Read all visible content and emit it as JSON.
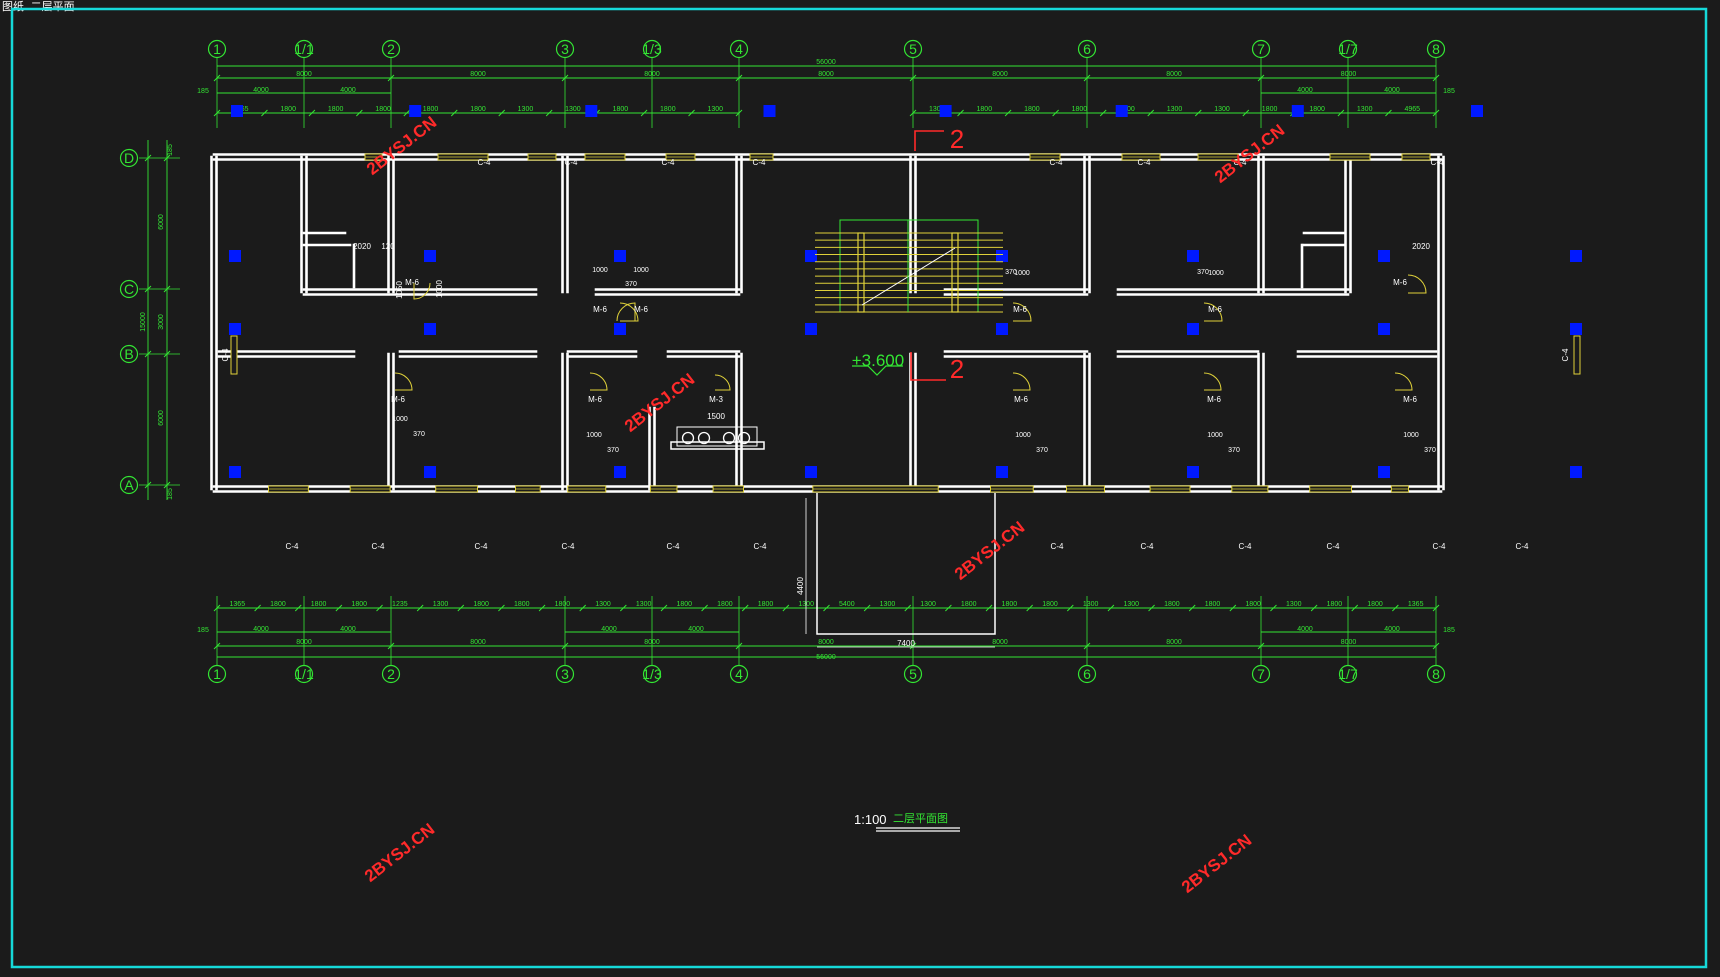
{
  "corner_tag": "图纸 二层平面",
  "grid_axes": [
    "1",
    "1/1",
    "2",
    "3",
    "1/3",
    "4",
    "5",
    "6",
    "7",
    "1/7",
    "8"
  ],
  "grid_rows": [
    "D",
    "C",
    "B",
    "A"
  ],
  "overall_dimension": "56000",
  "bay_dimensions": [
    "8000",
    "8000",
    "8000",
    "8000",
    "8000",
    "8000",
    "8000"
  ],
  "sub_dimensions_left": [
    "4000",
    "4000"
  ],
  "sub_dimensions_right": [
    "4000",
    "4000"
  ],
  "edge_dimension": "185",
  "top_detail_dims": [
    "4965",
    "1800",
    "1800",
    "1800",
    "1800",
    "1800",
    "1300",
    "1300",
    "1800",
    "1800",
    "1300",
    "1300",
    "1800",
    "1800",
    "1800",
    "1800",
    "1300",
    "1300",
    "1800",
    "1800",
    "1300",
    "4965"
  ],
  "bottom_detail_dims": [
    "1365",
    "1800",
    "1800",
    "1800",
    "1235",
    "1300",
    "1800",
    "1800",
    "1800",
    "1300",
    "1300",
    "1800",
    "1800",
    "1800",
    "1300",
    "5400",
    "1300",
    "1300",
    "1800",
    "1800",
    "1800",
    "1300",
    "1300",
    "1800",
    "1800",
    "1800",
    "1300",
    "1800",
    "1800",
    "1365"
  ],
  "left_dims": [
    "6000",
    "3000",
    "6000",
    "15000"
  ],
  "window_label": "C-4",
  "door_label": "M-6",
  "door_label_small": "M-3",
  "door_width": "1000",
  "door_offset": "370",
  "toilet_dims": [
    "2020",
    "120",
    "1000",
    "1050"
  ],
  "wash_dim": "1500",
  "entrance_dims": [
    "7400",
    "4400"
  ],
  "section_mark": "2",
  "elevation": "+3.600",
  "scale_text": "1:100",
  "drawing_title": "二层平面图",
  "watermark": "2BYSJ.CN",
  "colors": {
    "frame": "#16d9d9",
    "wall": "#ffffff",
    "dim": "#33e633",
    "column": "#0019ff",
    "window": "#e0d23a",
    "annotation": "#ff2a2a",
    "background": "#1b1b1b"
  }
}
